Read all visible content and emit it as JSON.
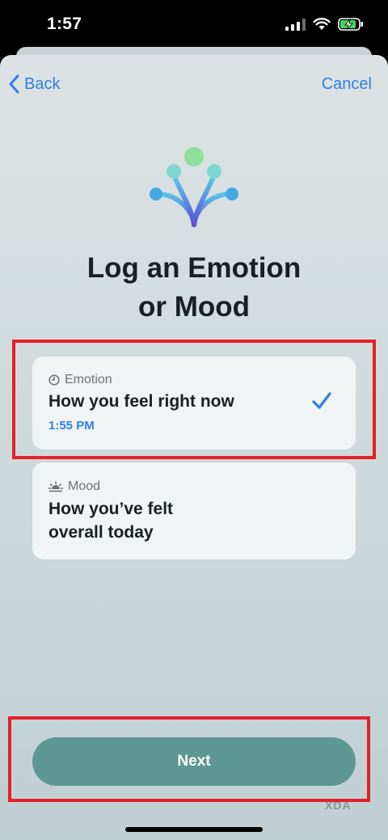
{
  "status_bar": {
    "time": "1:57",
    "signal_bars": 3,
    "battery_level": 0.8,
    "charging": true
  },
  "nav": {
    "back_label": "Back",
    "cancel_label": "Cancel"
  },
  "title": {
    "line1": "Log an Emotion",
    "line2": "or Mood"
  },
  "options": [
    {
      "kind": "Emotion",
      "icon": "clock-icon",
      "line1": "How you feel right now",
      "time": "1:55 PM",
      "selected": true
    },
    {
      "kind": "Mood",
      "icon": "sunrise-icon",
      "line1": "How you’ve felt",
      "line2": "overall today",
      "selected": false
    }
  ],
  "next_button": {
    "label": "Next"
  },
  "watermark": "XDA",
  "colors": {
    "accent": "#2f7fe0",
    "button": "#5d9893",
    "highlight": "#e4202b"
  }
}
